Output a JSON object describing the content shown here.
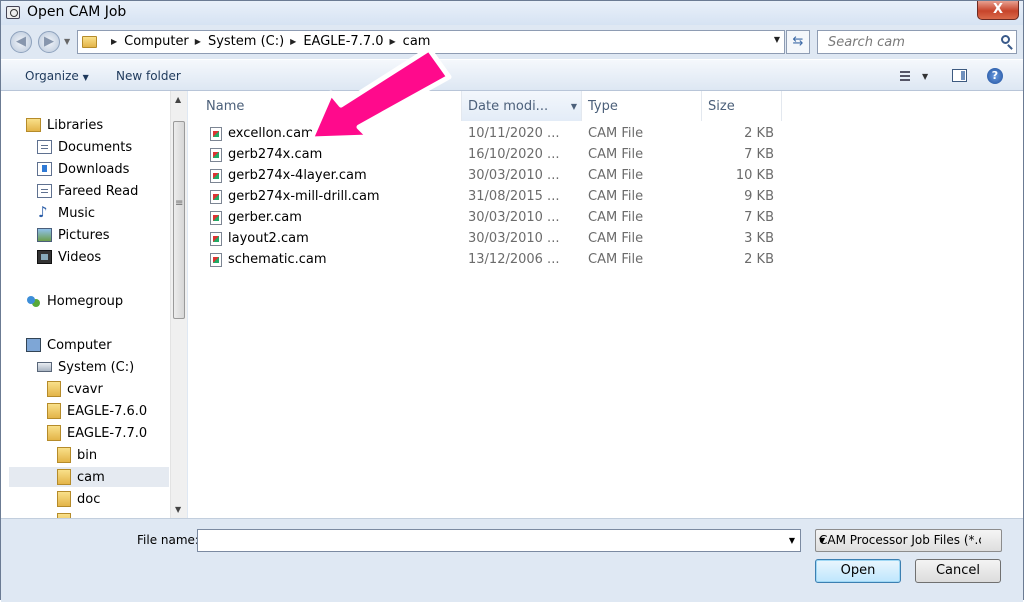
{
  "window": {
    "title": "Open CAM Job",
    "close_label": "X"
  },
  "address": {
    "crumbs": [
      "Computer",
      "System (C:)",
      "EAGLE-7.7.0",
      "cam"
    ],
    "search_placeholder": "Search cam"
  },
  "toolbar": {
    "organize": "Organize",
    "new_folder": "New folder",
    "help": "?"
  },
  "nav": {
    "libraries": "Libraries",
    "library_items": [
      "Documents",
      "Downloads",
      "Fareed Read",
      "Music",
      "Pictures",
      "Videos"
    ],
    "homegroup": "Homegroup",
    "computer": "Computer",
    "drive": "System (C:)",
    "folders": [
      "cvavr",
      "EAGLE-7.6.0",
      "EAGLE-7.7.0",
      "bin",
      "cam",
      "doc"
    ]
  },
  "columns": {
    "name": "Name",
    "date": "Date modi...",
    "type": "Type",
    "size": "Size"
  },
  "files": [
    {
      "name": "excellon.cam",
      "date": "10/11/2020 ...",
      "type": "CAM File",
      "size": "2 KB"
    },
    {
      "name": "gerb274x.cam",
      "date": "16/10/2020 ...",
      "type": "CAM File",
      "size": "7 KB"
    },
    {
      "name": "gerb274x-4layer.cam",
      "date": "30/03/2010 ...",
      "type": "CAM File",
      "size": "10 KB"
    },
    {
      "name": "gerb274x-mill-drill.cam",
      "date": "31/08/2015 ...",
      "type": "CAM File",
      "size": "9 KB"
    },
    {
      "name": "gerber.cam",
      "date": "30/03/2010 ...",
      "type": "CAM File",
      "size": "7 KB"
    },
    {
      "name": "layout2.cam",
      "date": "30/03/2010 ...",
      "type": "CAM File",
      "size": "3 KB"
    },
    {
      "name": "schematic.cam",
      "date": "13/12/2006 ...",
      "type": "CAM File",
      "size": "2 KB"
    }
  ],
  "bottom": {
    "file_name_label": "File name:",
    "file_name_value": "",
    "filter": "CAM Processor Job Files (*.cam",
    "open": "Open",
    "cancel": "Cancel"
  },
  "colors": {
    "annotation_arrow": "#ff0a8c"
  }
}
